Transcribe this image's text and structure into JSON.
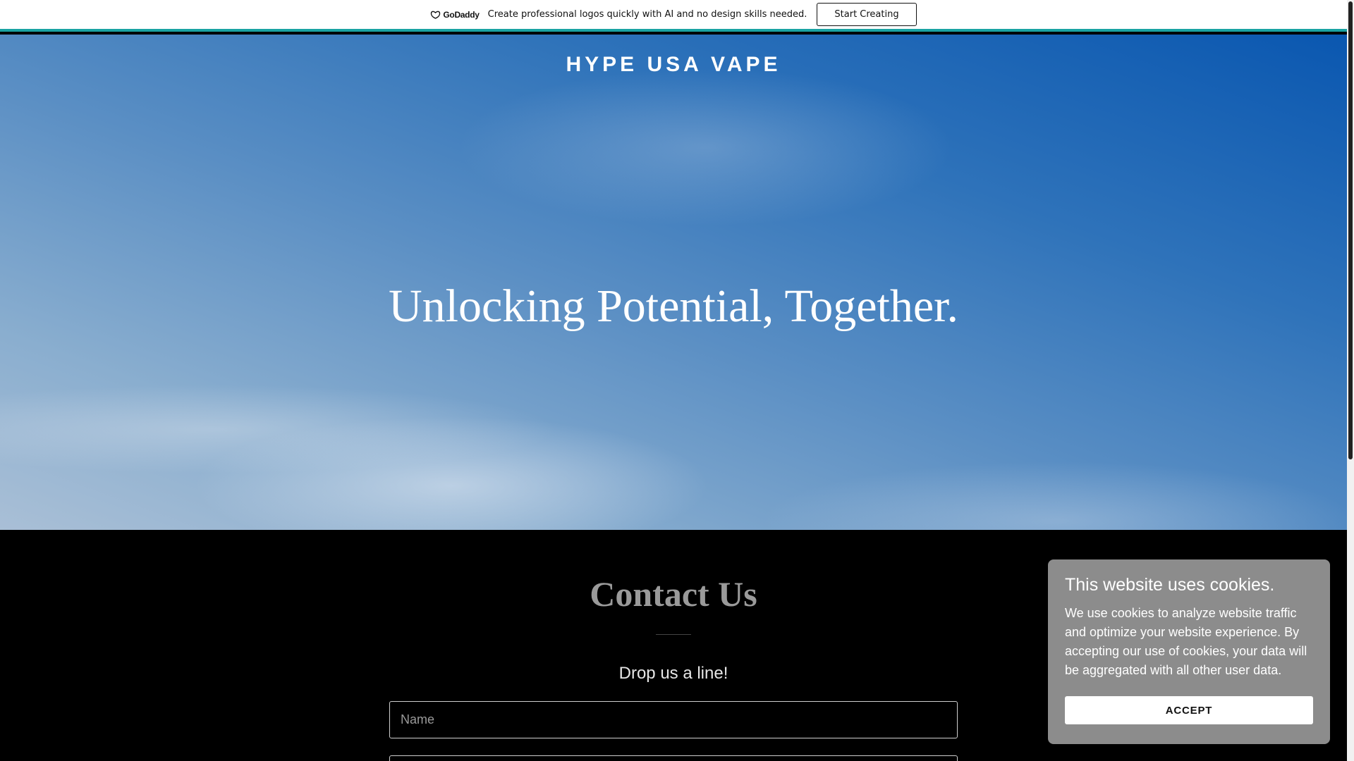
{
  "promo": {
    "brand": "GoDaddy",
    "text": "Create professional logos quickly with AI and no design skills needed.",
    "cta_label": "Start Creating"
  },
  "hero": {
    "site_name": "HYPE USA VAPE",
    "headline": "Unlocking Potential, Together."
  },
  "contact": {
    "title": "Contact Us",
    "subtitle": "Drop us a line!",
    "name_placeholder": "Name",
    "email_placeholder": ""
  },
  "cookie": {
    "title": "This website uses cookies.",
    "text": "We use cookies to analyze website traffic and optimize your website experience. By accepting our use of cookies, your data will be aggregated with all other user data.",
    "accept_label": "ACCEPT"
  },
  "colors": {
    "promo_accent": "#1aa3a3",
    "contact_bg": "#000000",
    "cookie_bg": "#8c8c8c"
  },
  "icons": [
    "godaddy-logo-icon"
  ]
}
